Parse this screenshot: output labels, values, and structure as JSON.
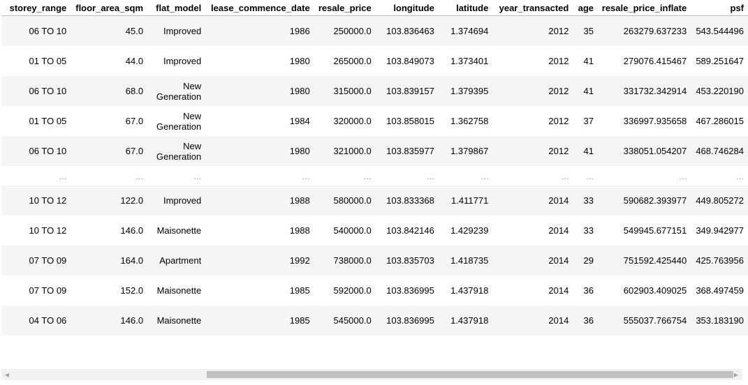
{
  "columns": [
    "storey_range",
    "floor_area_sqm",
    "flat_model",
    "lease_commence_date",
    "resale_price",
    "longitude",
    "latitude",
    "year_transacted",
    "age",
    "resale_price_inflate",
    "psf"
  ],
  "rows_top": [
    [
      "06 TO 10",
      "45.0",
      "Improved",
      "1986",
      "250000.0",
      "103.836463",
      "1.374694",
      "2012",
      "35",
      "263279.637233",
      "543.544496"
    ],
    [
      "01 TO 05",
      "44.0",
      "Improved",
      "1980",
      "265000.0",
      "103.849073",
      "1.373401",
      "2012",
      "41",
      "279076.415467",
      "589.251647"
    ],
    [
      "06 TO 10",
      "68.0",
      "New Generation",
      "1980",
      "315000.0",
      "103.839157",
      "1.379395",
      "2012",
      "41",
      "331732.342914",
      "453.220190"
    ],
    [
      "01 TO 05",
      "67.0",
      "New Generation",
      "1984",
      "320000.0",
      "103.858015",
      "1.362758",
      "2012",
      "37",
      "336997.935658",
      "467.286015"
    ],
    [
      "06 TO 10",
      "67.0",
      "New Generation",
      "1980",
      "321000.0",
      "103.835977",
      "1.379867",
      "2012",
      "41",
      "338051.054207",
      "468.746284"
    ]
  ],
  "ellipsis_row": [
    "...",
    "...",
    "...",
    "...",
    "...",
    "...",
    "...",
    "...",
    "...",
    "...",
    "..."
  ],
  "rows_bottom": [
    [
      "10 TO 12",
      "122.0",
      "Improved",
      "1988",
      "580000.0",
      "103.833368",
      "1.411771",
      "2014",
      "33",
      "590682.393977",
      "449.805272"
    ],
    [
      "10 TO 12",
      "146.0",
      "Maisonette",
      "1988",
      "540000.0",
      "103.842146",
      "1.429239",
      "2014",
      "33",
      "549945.677151",
      "349.942977"
    ],
    [
      "07 TO 09",
      "164.0",
      "Apartment",
      "1992",
      "738000.0",
      "103.835703",
      "1.418735",
      "2014",
      "29",
      "751592.425440",
      "425.763956"
    ],
    [
      "07 TO 09",
      "152.0",
      "Maisonette",
      "1985",
      "592000.0",
      "103.836995",
      "1.437918",
      "2014",
      "36",
      "602903.409025",
      "368.497459"
    ],
    [
      "04 TO 06",
      "146.0",
      "Maisonette",
      "1985",
      "545000.0",
      "103.836995",
      "1.437918",
      "2014",
      "36",
      "555037.766754",
      "353.183190"
    ]
  ],
  "scrollbar": {
    "left_arrow": "◀",
    "right_arrow": "▶",
    "left_icon": "triangle-left-icon",
    "right_icon": "triangle-right-icon"
  },
  "colors": {
    "odd_row": "#f5f5f5",
    "even_row": "#ffffff",
    "scroll_thumb": "#c1c1c1"
  }
}
